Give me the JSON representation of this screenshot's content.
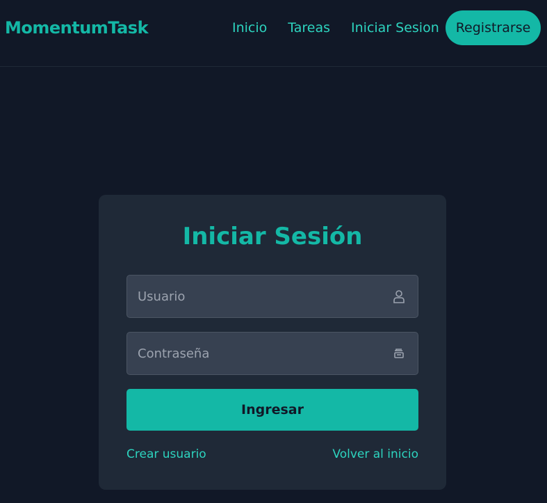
{
  "nav": {
    "brand": "MomentumTask",
    "links": [
      "Inicio",
      "Tareas",
      "Iniciar Sesion"
    ],
    "register_label": "Registrarse"
  },
  "login": {
    "title": "Iniciar Sesión",
    "username_placeholder": "Usuario",
    "username_icon": "user-icon",
    "password_placeholder": "Contraseña",
    "password_icon": "lock-icon",
    "submit_label": "Ingresar",
    "create_user_label": "Crear usuario",
    "back_home_label": "Volver al inicio"
  },
  "colors": {
    "background": "#111827",
    "card": "#1f2937",
    "input": "#374151",
    "accent": "#14b8a6",
    "accent_text": "#2dd4bf"
  }
}
